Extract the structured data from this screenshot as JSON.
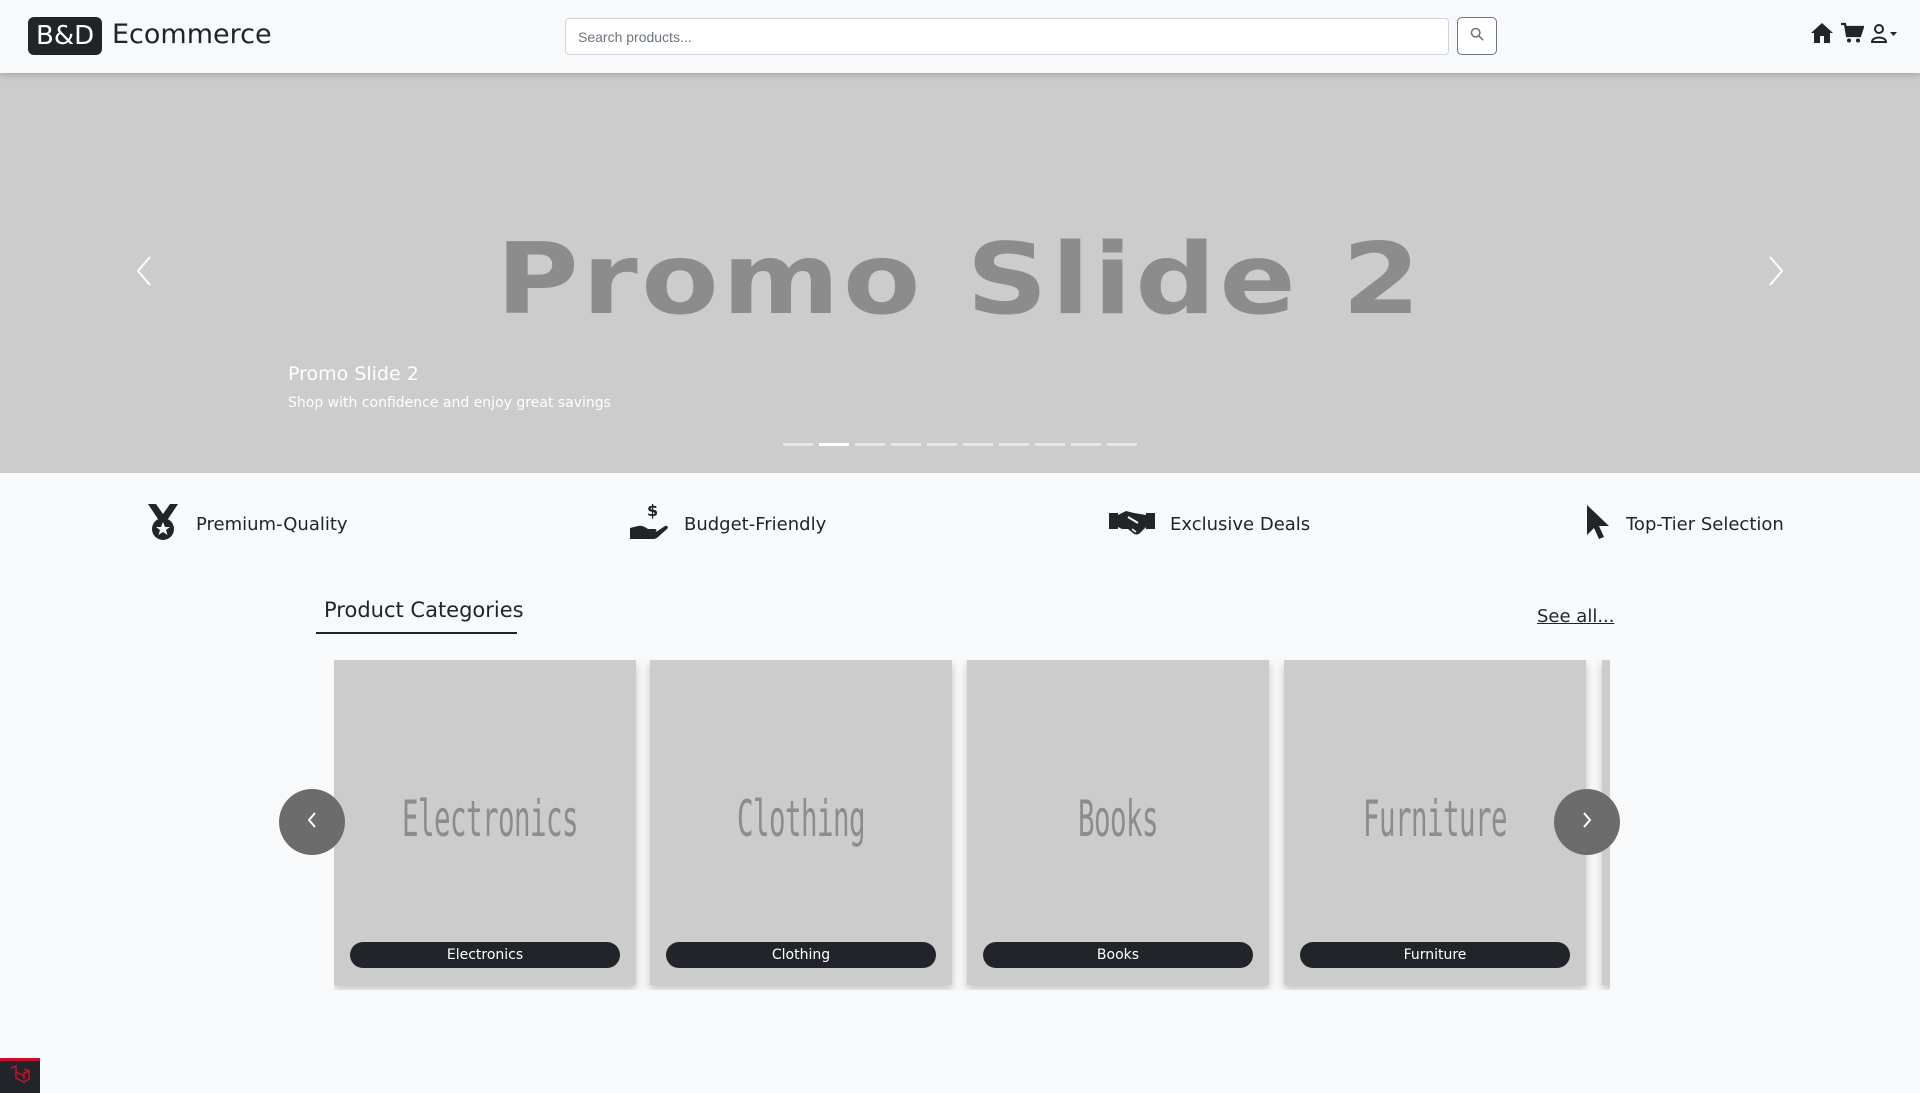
{
  "header": {
    "logo": "B&D",
    "brand": "Ecommerce",
    "search_placeholder": "Search products..."
  },
  "hero": {
    "image_text": "Promo Slide 2",
    "caption_title": "Promo Slide 2",
    "caption_text": "Shop with confidence and enjoy great savings",
    "indicator_count": 10,
    "active_index": 1
  },
  "features": [
    {
      "label": "Premium-Quality",
      "icon": "medal-icon"
    },
    {
      "label": "Budget-Friendly",
      "icon": "hand-dollar-icon"
    },
    {
      "label": "Exclusive Deals",
      "icon": "handshake-icon"
    },
    {
      "label": "Top-Tier Selection",
      "icon": "cursor-icon"
    }
  ],
  "categories": {
    "title": "Product Categories",
    "see_all": "See all...",
    "items": [
      {
        "image_text": "Electronics",
        "label": "Electronics"
      },
      {
        "image_text": "Clothing",
        "label": "Clothing"
      },
      {
        "image_text": "Books",
        "label": "Books"
      },
      {
        "image_text": "Furniture",
        "label": "Furniture"
      }
    ]
  },
  "colors": {
    "dark": "#212529",
    "placeholder_bg": "#cccccc",
    "placeholder_text": "#8c8c8c",
    "page_bg": "#f8f9fa"
  }
}
